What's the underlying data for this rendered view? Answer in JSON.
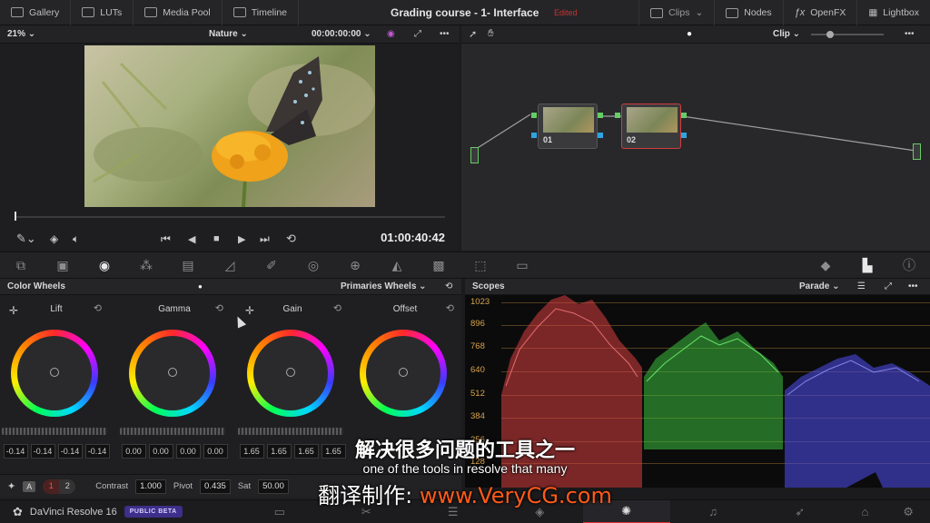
{
  "topbar": {
    "left_items": [
      {
        "label": "Gallery",
        "icon": "gallery-icon"
      },
      {
        "label": "LUTs",
        "icon": "luts-icon"
      },
      {
        "label": "Media Pool",
        "icon": "media-pool-icon"
      },
      {
        "label": "Timeline",
        "icon": "timeline-icon"
      }
    ],
    "project_title": "Grading course - 1- Interface",
    "edited_label": "Edited",
    "right_items": [
      {
        "label": "Clips",
        "icon": "clips-icon"
      },
      {
        "label": "Nodes",
        "icon": "nodes-icon"
      },
      {
        "label": "OpenFX",
        "icon": "fx-icon"
      },
      {
        "label": "Lightbox",
        "icon": "lightbox-icon"
      }
    ]
  },
  "viewer": {
    "zoom": "21%",
    "clip_name": "Nature",
    "source_timecode": "00:00:00:00",
    "record_timecode": "01:00:40:42"
  },
  "node_editor": {
    "mode": "Clip",
    "nodes": [
      {
        "label": "01",
        "selected": false
      },
      {
        "label": "02",
        "selected": true
      }
    ]
  },
  "color_wheels": {
    "title": "Color Wheels",
    "mode": "Primaries Wheels",
    "wheels": [
      {
        "name": "Lift",
        "values": [
          "-0.14",
          "-0.14",
          "-0.14",
          "-0.14"
        ]
      },
      {
        "name": "Gamma",
        "values": [
          "0.00",
          "0.00",
          "0.00",
          "0.00"
        ]
      },
      {
        "name": "Gain",
        "values": [
          "1.65",
          "1.65",
          "1.65",
          "1.65"
        ]
      },
      {
        "name": "Offset",
        "values": [
          "",
          "",
          "",
          ""
        ]
      }
    ],
    "adjust": {
      "pages": [
        "1",
        "2"
      ],
      "contrast_label": "Contrast",
      "contrast": "1.000",
      "pivot_label": "Pivot",
      "pivot": "0.435",
      "sat_label": "Sat",
      "sat": "50.00"
    }
  },
  "scopes": {
    "title": "Scopes",
    "mode": "Parade",
    "scale": [
      "1023",
      "896",
      "768",
      "640",
      "512",
      "384",
      "256",
      "128"
    ]
  },
  "status": {
    "app_name": "DaVinci Resolve 16",
    "beta": "PUBLIC BETA"
  },
  "subtitles": {
    "line1": "解决很多问题的工具之一",
    "line2": "one of the tools in resolve that many",
    "line3_prefix": "翻译制作: ",
    "line3_url": "www.VeryCG.com"
  },
  "colors": {
    "accent_red": "#d23c3c",
    "scope_red": "#ff4d4d",
    "scope_green": "#3ddc3d",
    "scope_blue": "#5a5aff"
  }
}
